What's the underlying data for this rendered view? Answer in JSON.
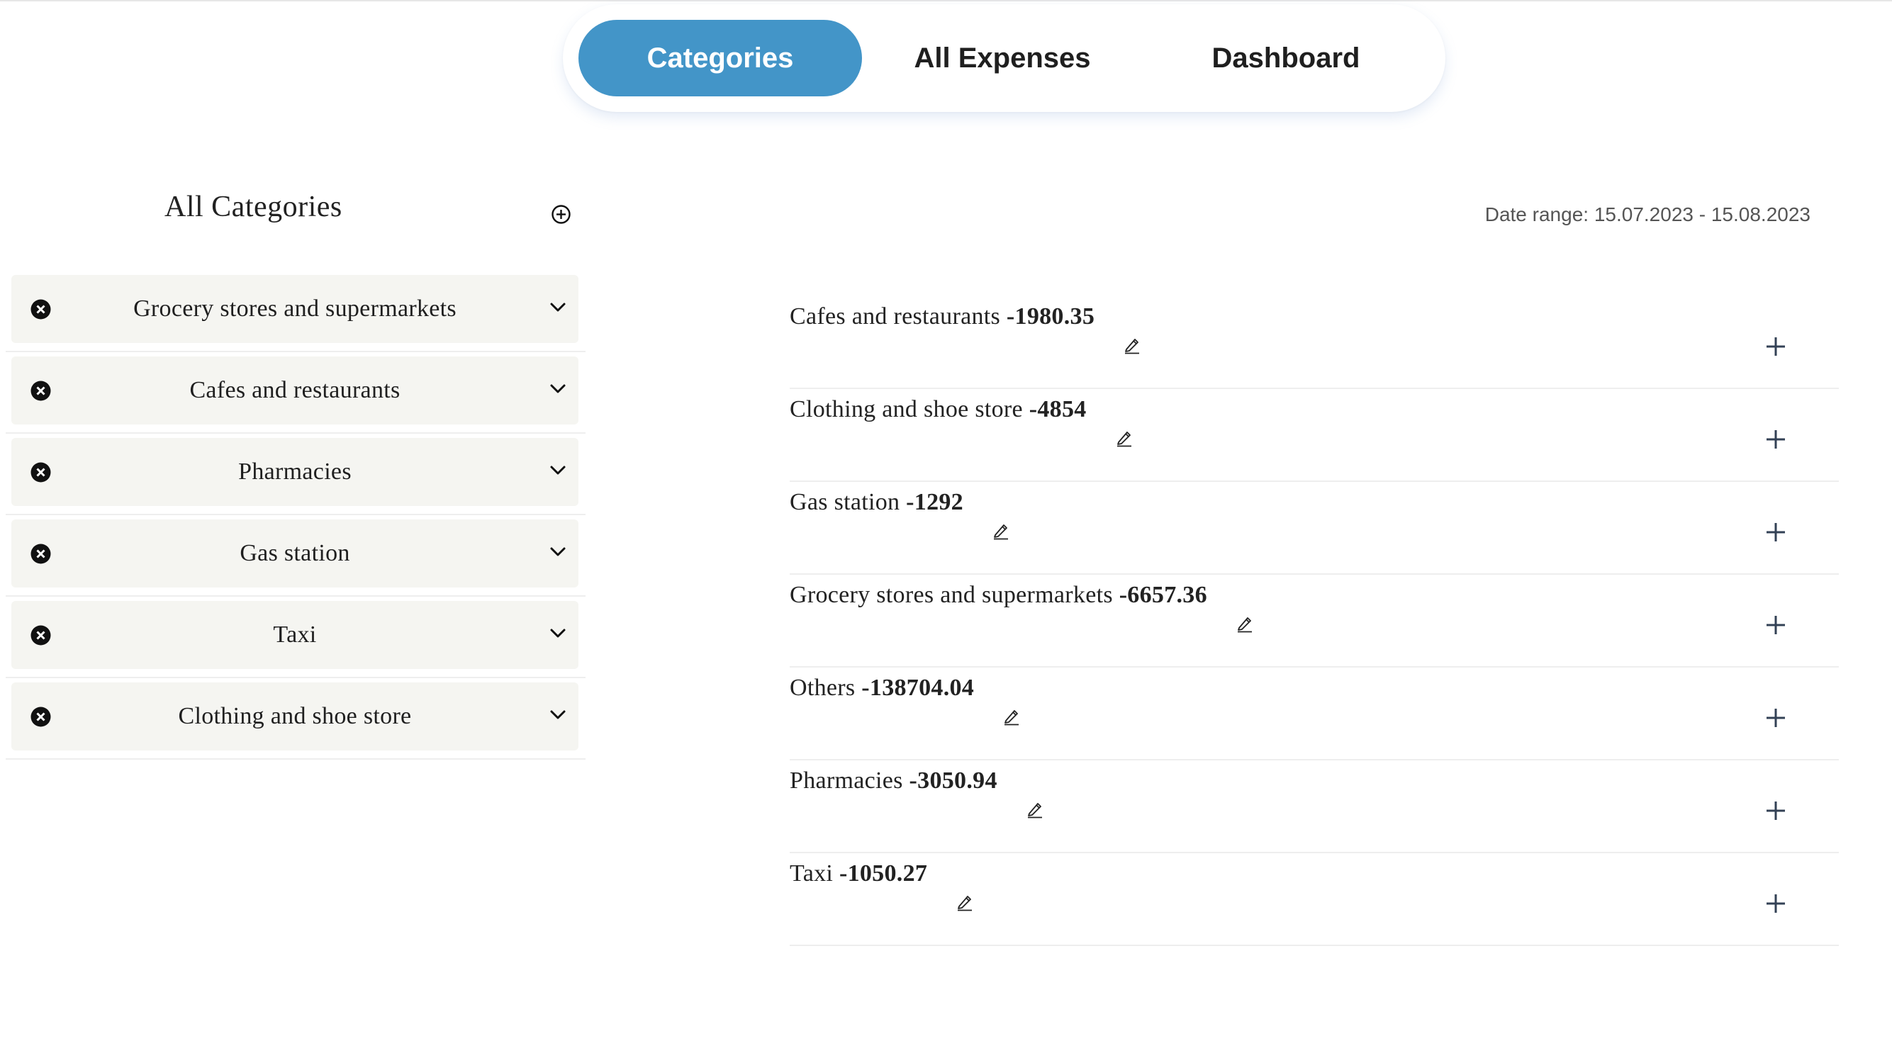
{
  "nav": {
    "tabs": [
      {
        "label": "Categories",
        "active": true
      },
      {
        "label": "All Expenses",
        "active": false
      },
      {
        "label": "Dashboard",
        "active": false
      }
    ],
    "accent_color": "#4395c8"
  },
  "left_panel": {
    "title": "All Categories",
    "add_icon": "plus-circle-icon",
    "categories": [
      {
        "label": "Grocery stores and supermarkets"
      },
      {
        "label": "Cafes and restaurants"
      },
      {
        "label": "Pharmacies"
      },
      {
        "label": "Gas station"
      },
      {
        "label": "Taxi"
      },
      {
        "label": "Clothing and shoe store"
      }
    ]
  },
  "right_panel": {
    "date_range": "Date range: 15.07.2023 - 15.08.2023",
    "expenses": [
      {
        "name": "Cafes and restaurants",
        "amount": "-1980.35"
      },
      {
        "name": "Clothing and shoe store",
        "amount": "-4854"
      },
      {
        "name": "Gas station",
        "amount": "-1292"
      },
      {
        "name": "Grocery stores and supermarkets",
        "amount": "-6657.36"
      },
      {
        "name": "Others",
        "amount": "-138704.04"
      },
      {
        "name": "Pharmacies",
        "amount": "-3050.94"
      },
      {
        "name": "Taxi",
        "amount": "-1050.27"
      }
    ]
  }
}
